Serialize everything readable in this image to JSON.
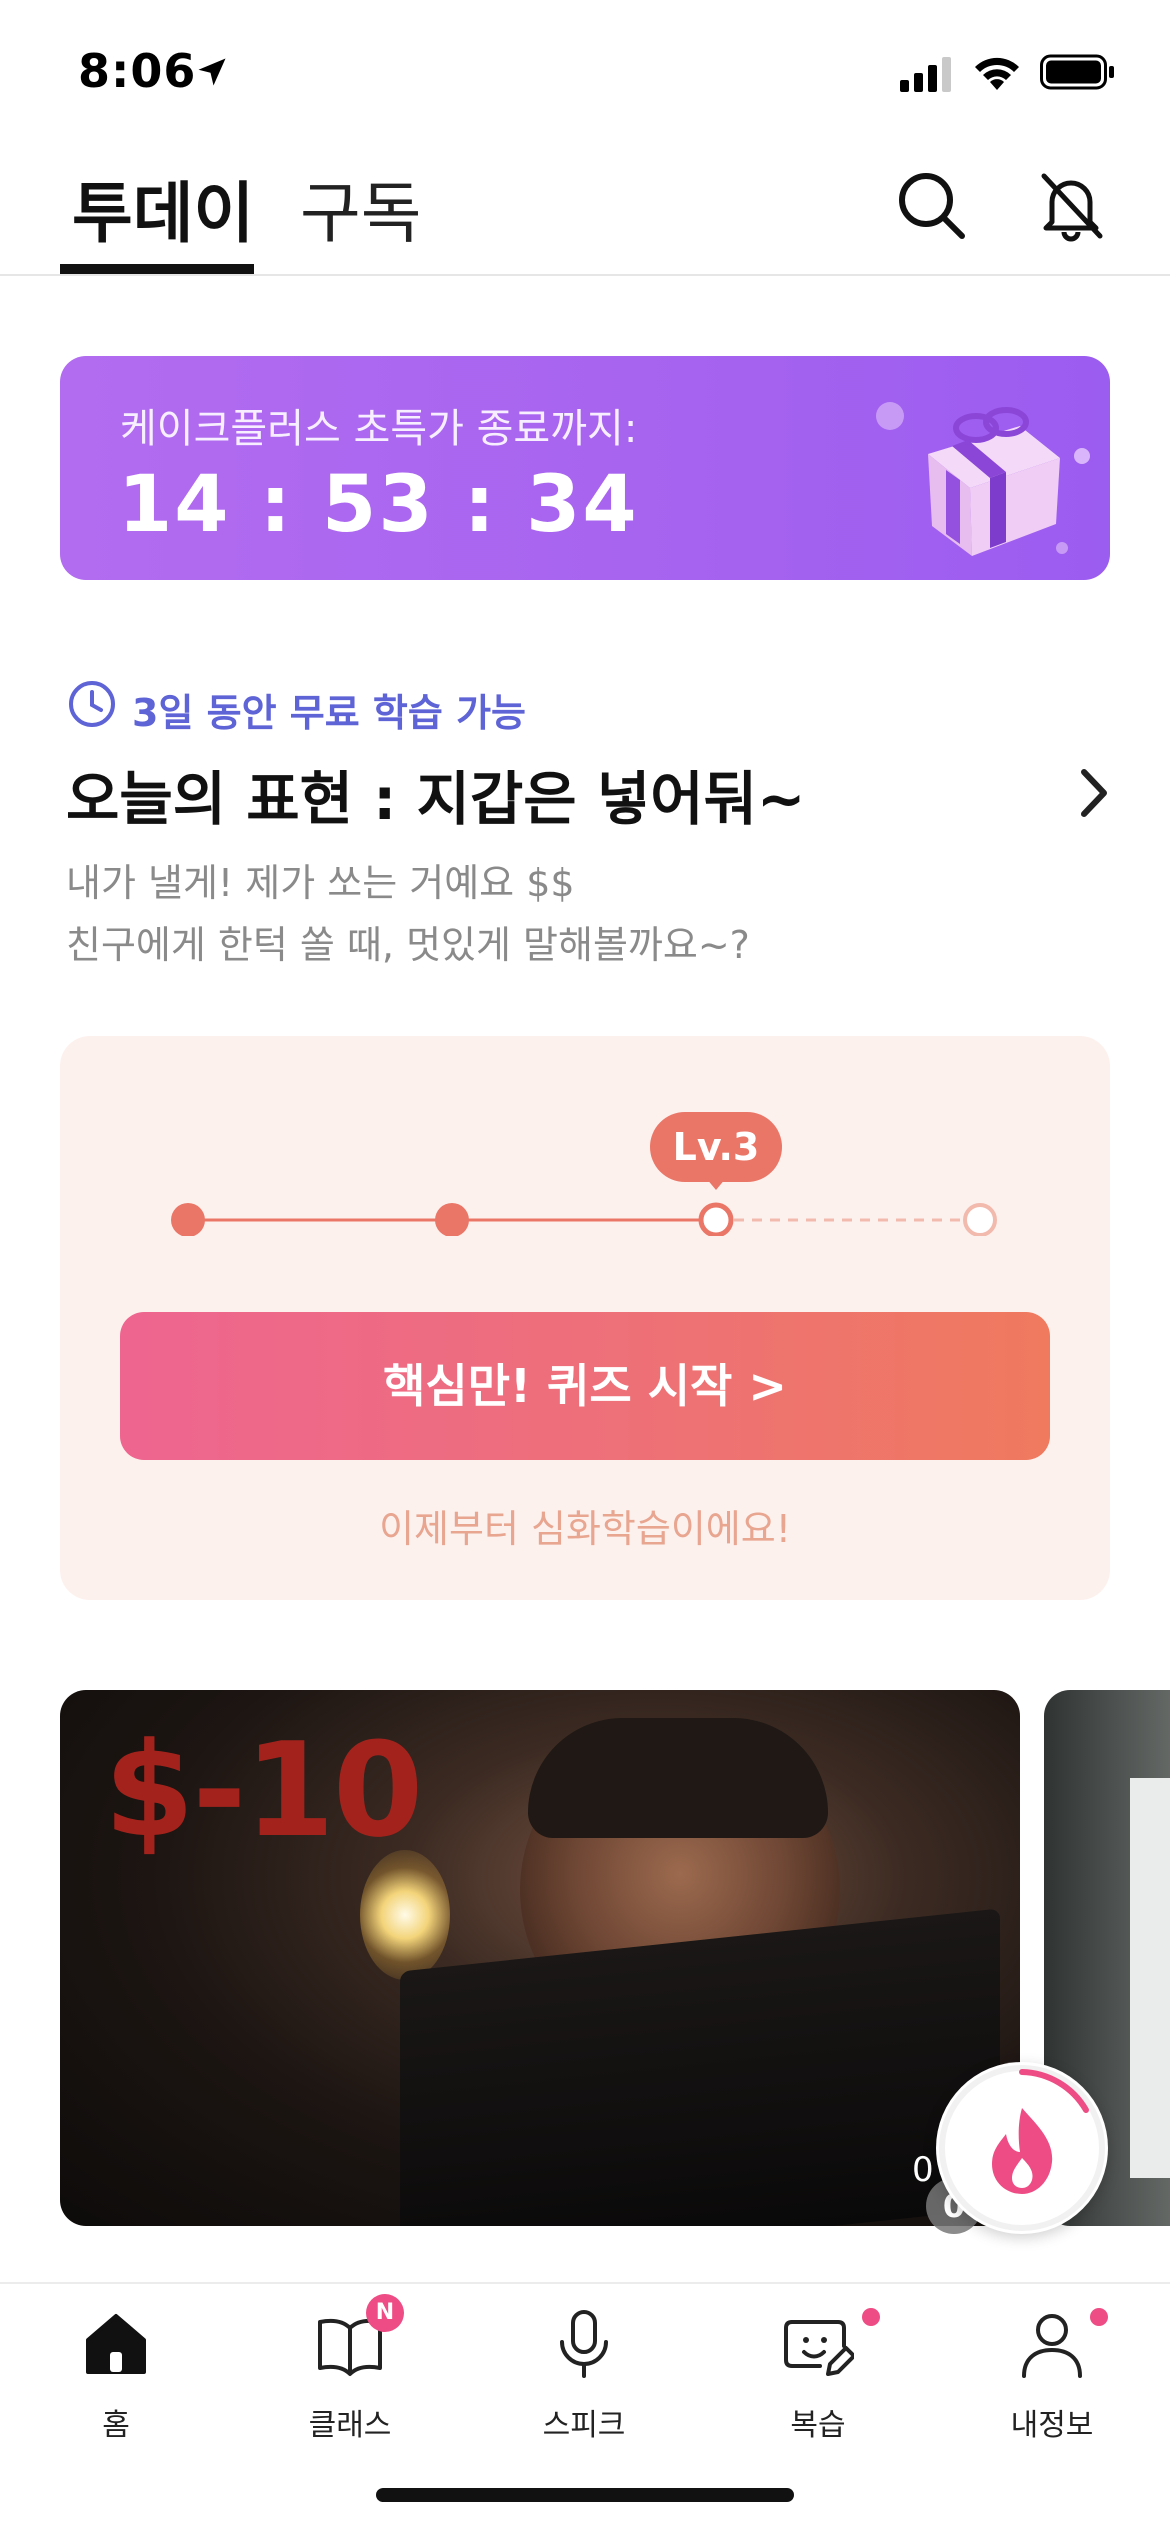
{
  "status_bar": {
    "time": "8:06"
  },
  "header": {
    "tabs": [
      {
        "label": "투데이",
        "active": true
      },
      {
        "label": "구독",
        "active": false
      }
    ]
  },
  "promo": {
    "label": "케이크플러스 초특가 종료까지:",
    "timer": "14 : 53 : 34",
    "colors": {
      "start": "#b26cf0",
      "end": "#9b5cf0"
    }
  },
  "expression": {
    "free_label": "3일 동안 무료 학습 가능",
    "title": "오늘의 표현 : 지갑은 넣어둬~",
    "desc_line1": "내가 낼게! 제가 쏘는 거예요 $$",
    "desc_line2": "친구에게 한턱 쏠 때, 멋있게 말해볼까요~?"
  },
  "quiz": {
    "level_label": "Lv.3",
    "progress": {
      "current_step": 3,
      "total_steps": 4
    },
    "button_label": "핵심만! 퀴즈 시작 >",
    "sub_label": "이제부터 심화학습이에요!",
    "accent": "#ea7667"
  },
  "videos": [
    {
      "overlay_text": "$-10"
    }
  ],
  "streak": {
    "count": "0",
    "badge": "0"
  },
  "bottom_nav": {
    "items": [
      {
        "label": "홈",
        "icon": "home-icon",
        "active": true
      },
      {
        "label": "클래스",
        "icon": "book-icon",
        "badge": "N"
      },
      {
        "label": "스피크",
        "icon": "mic-icon"
      },
      {
        "label": "복습",
        "icon": "review-face-icon",
        "dot": true
      },
      {
        "label": "내정보",
        "icon": "person-icon",
        "dot": true
      }
    ]
  }
}
